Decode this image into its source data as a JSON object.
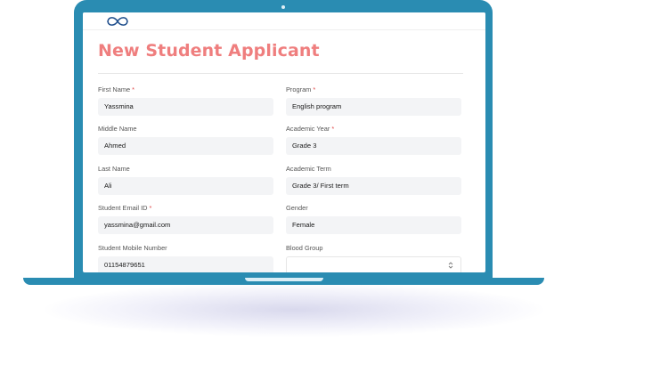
{
  "page": {
    "title": "New Student Applicant"
  },
  "fields": {
    "first_name": {
      "label": "First Name",
      "required": "*",
      "value": "Yassmina"
    },
    "middle_name": {
      "label": "Middle Name",
      "value": "Ahmed"
    },
    "last_name": {
      "label": "Last Name",
      "value": "Ali"
    },
    "email": {
      "label": "Student Email ID",
      "required": "*",
      "value": "yassmina@gmail.com"
    },
    "mobile": {
      "label": "Student Mobile Number",
      "value": "01154879651"
    },
    "program": {
      "label": "Program",
      "required": "*",
      "value": "English program"
    },
    "academic_year": {
      "label": "Academic Year",
      "required": "*",
      "value": "Grade 3"
    },
    "academic_term": {
      "label": "Academic Term",
      "value": "Grade 3/ First term"
    },
    "gender": {
      "label": "Gender",
      "value": "Female"
    },
    "blood_group": {
      "label": "Blood Group",
      "value": ""
    }
  },
  "colors": {
    "laptop_frame": "#2a8cb2",
    "title_accent": "#ef7e7e",
    "required_mark": "#e04848",
    "input_bg": "#f3f4f6",
    "logo": "#1f4e8c"
  },
  "icons": {
    "logo": "infinity-logo-icon",
    "select_stepper": "updown-chevron-icon"
  }
}
